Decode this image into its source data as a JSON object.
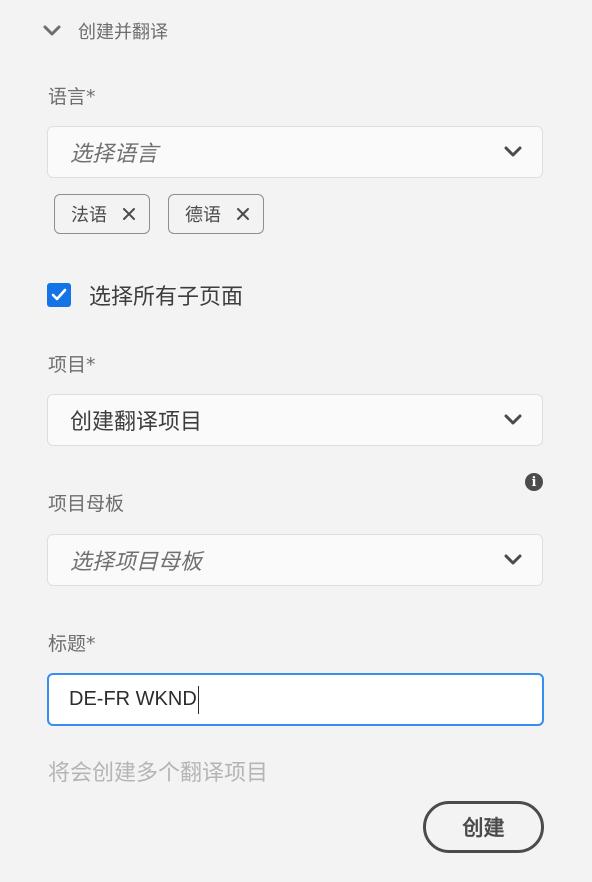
{
  "section": {
    "title": "创建并翻译",
    "icon": "chevron-down-icon"
  },
  "language": {
    "label": "语言*",
    "placeholder": "选择语言",
    "tags": [
      {
        "label": "法语"
      },
      {
        "label": "德语"
      }
    ]
  },
  "select_all_subpages": {
    "label": "选择所有子页面",
    "checked": true
  },
  "project": {
    "label": "项目*",
    "value": "创建翻译项目"
  },
  "project_template": {
    "label": "项目母板",
    "placeholder": "选择项目母板",
    "info_icon": "info-icon"
  },
  "title_field": {
    "label": "标题*",
    "value": "DE-FR WKND"
  },
  "helper_text": "将会创建多个翻译项目",
  "create_button": {
    "label": "创建"
  },
  "colors": {
    "background": "#f3f3f3",
    "accent": "#1473e6",
    "focus_border": "#378ef0",
    "text": "#4b4b4b"
  }
}
